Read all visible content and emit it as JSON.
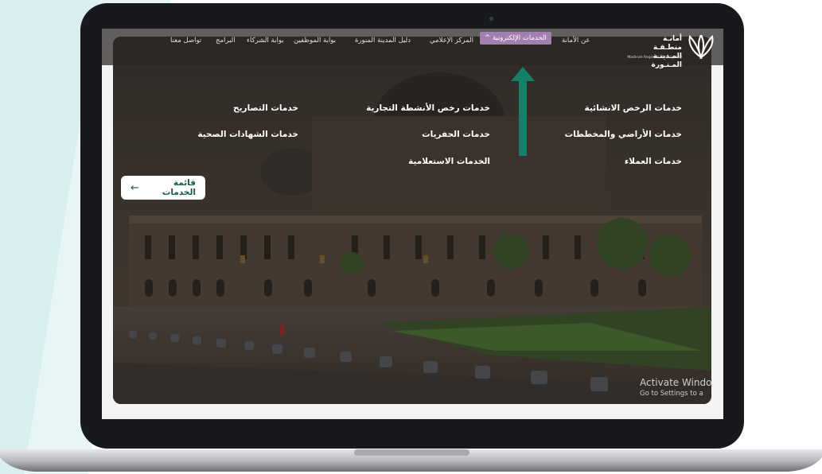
{
  "nav": {
    "items": [
      {
        "label": "عن الأمانة"
      },
      {
        "label": "الخدمات الإلكترونية ^"
      },
      {
        "label": "المركز الإعلامي"
      },
      {
        "label": "دليل المدينة المنورة"
      },
      {
        "label": "بوابة الموظفين"
      },
      {
        "label": "بوابة الشركاء"
      },
      {
        "label": "البرامج"
      },
      {
        "label": "تواصل معنا"
      }
    ],
    "logo_ar": "أمانـة منطـقـة المـدينـة المـنـورة",
    "logo_en": "Madinah Regional Municipality"
  },
  "menu": {
    "col1": [
      "خدمات الرخص الانشائية",
      "خدمات الأراضي والمخططات",
      "خدمات العملاء"
    ],
    "col2": [
      "خدمات رخص الأنشطة التجارية",
      "خدمات الحفريات",
      "الخدمات الاستعلامية"
    ],
    "col3": [
      "خدمات التصاريح",
      "خدمات الشهادات الصحية"
    ]
  },
  "services_list_button": "قائمة الخدمات",
  "watermark": {
    "title": "Activate Windo",
    "subtitle": "Go to Settings to a"
  },
  "colors": {
    "active_menu": "#a37fb0",
    "arrow": "#14806a",
    "button_text": "#12604c"
  }
}
